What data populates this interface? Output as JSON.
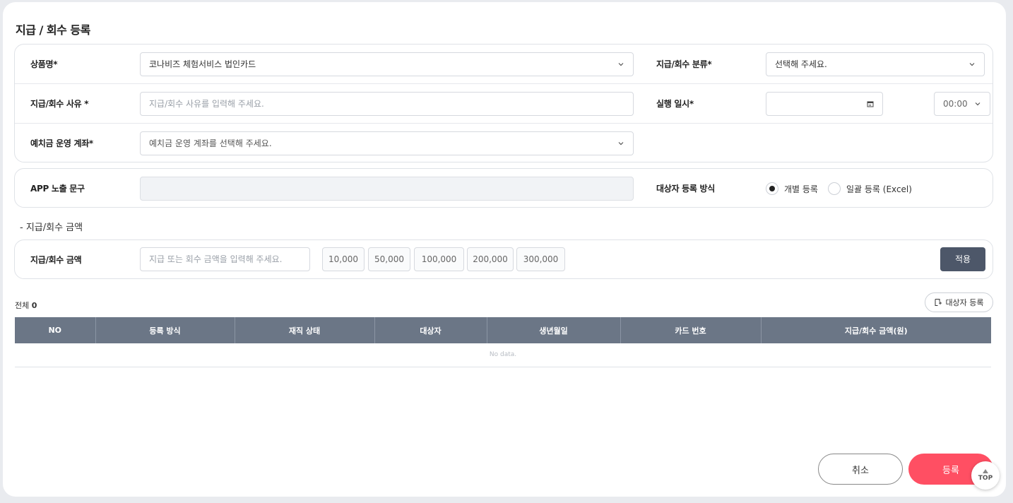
{
  "page_title": "지급 / 회수 등록",
  "form": {
    "product": {
      "label": "상품명*",
      "value": "코나비즈 체험서비스 법인카드"
    },
    "category": {
      "label": "지급/회수 분류*",
      "placeholder": "선택해 주세요."
    },
    "reason": {
      "label": "지급/회수 사유 *",
      "placeholder": "지급/회수 사유를 입력해 주세요."
    },
    "exec_date": {
      "label": "실행 일시*",
      "date": "",
      "time": "00:00"
    },
    "account": {
      "label": "예치금 운영 계좌*",
      "placeholder": "예치금 운영 계좌를 선택해 주세요."
    }
  },
  "app_text": {
    "label": "APP 노출 문구",
    "value": ""
  },
  "target_method": {
    "label": "대상자 등록 방식",
    "options": [
      "개별 등록",
      "일괄 등록 (Excel)"
    ],
    "selected": "개별 등록"
  },
  "amount_section": {
    "subtitle": "- 지급/회수 금액",
    "label": "지급/회수 금액",
    "placeholder": "지급 또는 회수 금액을 입력해 주세요.",
    "presets": [
      "10,000",
      "50,000",
      "100,000",
      "200,000",
      "300,000"
    ],
    "apply_label": "적용"
  },
  "list": {
    "total_label": "전체",
    "total_count": "0",
    "add_target_label": "대상자 등록",
    "columns": [
      "NO",
      "등록 방식",
      "재직 상태",
      "대상자",
      "생년월일",
      "카드 번호",
      "지급/회수 금액(원)"
    ],
    "empty_text": "No data."
  },
  "actions": {
    "cancel": "취소",
    "submit": "등록",
    "top": "TOP"
  },
  "colors": {
    "accent": "#ff4f63",
    "header": "#6b7686",
    "apply": "#4d5769"
  }
}
